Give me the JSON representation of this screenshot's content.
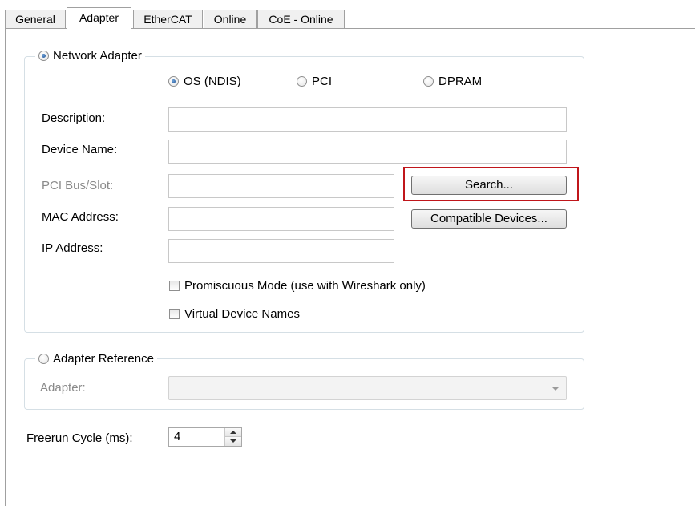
{
  "tabs": [
    {
      "label": "General"
    },
    {
      "label": "Adapter"
    },
    {
      "label": "EtherCAT"
    },
    {
      "label": "Online"
    },
    {
      "label": "CoE - Online"
    }
  ],
  "network_adapter": {
    "label": "Network Adapter",
    "selected": true,
    "modes": [
      {
        "label": "OS (NDIS)",
        "selected": true
      },
      {
        "label": "PCI",
        "selected": false
      },
      {
        "label": "DPRAM",
        "selected": false
      }
    ],
    "description_label": "Description:",
    "description_value": "",
    "device_name_label": "Device Name:",
    "device_name_value": "",
    "pci_bus_slot_label": "PCI Bus/Slot:",
    "pci_bus_slot_value": "",
    "mac_address_label": "MAC Address:",
    "mac_address_value": "",
    "ip_address_label": "IP Address:",
    "ip_address_value": "",
    "search_button": "Search...",
    "compatible_devices_button": "Compatible Devices...",
    "promiscuous_label": "Promiscuous Mode (use with Wireshark only)",
    "promiscuous_checked": false,
    "virtual_names_label": "Virtual Device Names",
    "virtual_names_checked": false
  },
  "adapter_reference": {
    "label": "Adapter Reference",
    "selected": false,
    "adapter_label": "Adapter:",
    "adapter_value": ""
  },
  "freerun": {
    "label": "Freerun Cycle (ms):",
    "value": "4"
  },
  "colors": {
    "highlight": "#c0161b",
    "group_border": "#d5dfe5"
  }
}
